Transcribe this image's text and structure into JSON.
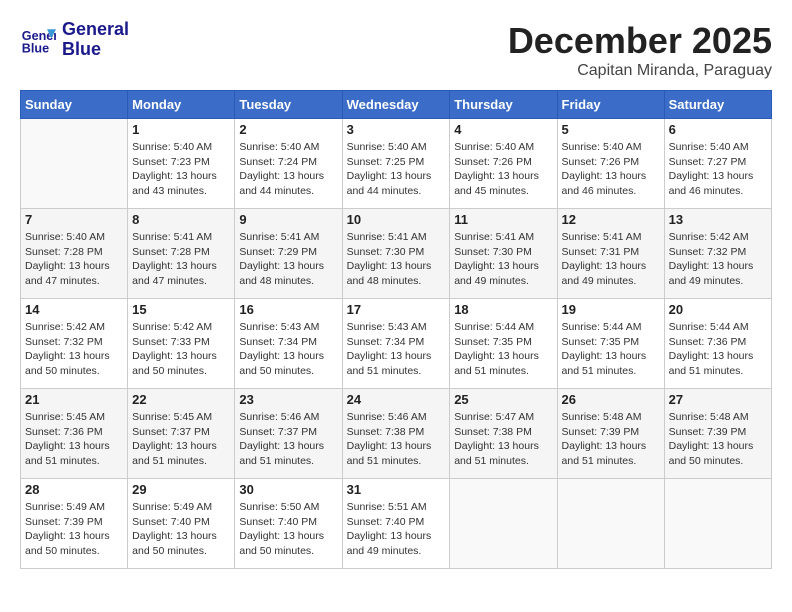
{
  "header": {
    "logo_line1": "General",
    "logo_line2": "Blue",
    "month_year": "December 2025",
    "location": "Capitan Miranda, Paraguay"
  },
  "weekdays": [
    "Sunday",
    "Monday",
    "Tuesday",
    "Wednesday",
    "Thursday",
    "Friday",
    "Saturday"
  ],
  "weeks": [
    [
      {
        "day": "",
        "info": ""
      },
      {
        "day": "1",
        "info": "Sunrise: 5:40 AM\nSunset: 7:23 PM\nDaylight: 13 hours\nand 43 minutes."
      },
      {
        "day": "2",
        "info": "Sunrise: 5:40 AM\nSunset: 7:24 PM\nDaylight: 13 hours\nand 44 minutes."
      },
      {
        "day": "3",
        "info": "Sunrise: 5:40 AM\nSunset: 7:25 PM\nDaylight: 13 hours\nand 44 minutes."
      },
      {
        "day": "4",
        "info": "Sunrise: 5:40 AM\nSunset: 7:26 PM\nDaylight: 13 hours\nand 45 minutes."
      },
      {
        "day": "5",
        "info": "Sunrise: 5:40 AM\nSunset: 7:26 PM\nDaylight: 13 hours\nand 46 minutes."
      },
      {
        "day": "6",
        "info": "Sunrise: 5:40 AM\nSunset: 7:27 PM\nDaylight: 13 hours\nand 46 minutes."
      }
    ],
    [
      {
        "day": "7",
        "info": "Sunrise: 5:40 AM\nSunset: 7:28 PM\nDaylight: 13 hours\nand 47 minutes."
      },
      {
        "day": "8",
        "info": "Sunrise: 5:41 AM\nSunset: 7:28 PM\nDaylight: 13 hours\nand 47 minutes."
      },
      {
        "day": "9",
        "info": "Sunrise: 5:41 AM\nSunset: 7:29 PM\nDaylight: 13 hours\nand 48 minutes."
      },
      {
        "day": "10",
        "info": "Sunrise: 5:41 AM\nSunset: 7:30 PM\nDaylight: 13 hours\nand 48 minutes."
      },
      {
        "day": "11",
        "info": "Sunrise: 5:41 AM\nSunset: 7:30 PM\nDaylight: 13 hours\nand 49 minutes."
      },
      {
        "day": "12",
        "info": "Sunrise: 5:41 AM\nSunset: 7:31 PM\nDaylight: 13 hours\nand 49 minutes."
      },
      {
        "day": "13",
        "info": "Sunrise: 5:42 AM\nSunset: 7:32 PM\nDaylight: 13 hours\nand 49 minutes."
      }
    ],
    [
      {
        "day": "14",
        "info": "Sunrise: 5:42 AM\nSunset: 7:32 PM\nDaylight: 13 hours\nand 50 minutes."
      },
      {
        "day": "15",
        "info": "Sunrise: 5:42 AM\nSunset: 7:33 PM\nDaylight: 13 hours\nand 50 minutes."
      },
      {
        "day": "16",
        "info": "Sunrise: 5:43 AM\nSunset: 7:34 PM\nDaylight: 13 hours\nand 50 minutes."
      },
      {
        "day": "17",
        "info": "Sunrise: 5:43 AM\nSunset: 7:34 PM\nDaylight: 13 hours\nand 51 minutes."
      },
      {
        "day": "18",
        "info": "Sunrise: 5:44 AM\nSunset: 7:35 PM\nDaylight: 13 hours\nand 51 minutes."
      },
      {
        "day": "19",
        "info": "Sunrise: 5:44 AM\nSunset: 7:35 PM\nDaylight: 13 hours\nand 51 minutes."
      },
      {
        "day": "20",
        "info": "Sunrise: 5:44 AM\nSunset: 7:36 PM\nDaylight: 13 hours\nand 51 minutes."
      }
    ],
    [
      {
        "day": "21",
        "info": "Sunrise: 5:45 AM\nSunset: 7:36 PM\nDaylight: 13 hours\nand 51 minutes."
      },
      {
        "day": "22",
        "info": "Sunrise: 5:45 AM\nSunset: 7:37 PM\nDaylight: 13 hours\nand 51 minutes."
      },
      {
        "day": "23",
        "info": "Sunrise: 5:46 AM\nSunset: 7:37 PM\nDaylight: 13 hours\nand 51 minutes."
      },
      {
        "day": "24",
        "info": "Sunrise: 5:46 AM\nSunset: 7:38 PM\nDaylight: 13 hours\nand 51 minutes."
      },
      {
        "day": "25",
        "info": "Sunrise: 5:47 AM\nSunset: 7:38 PM\nDaylight: 13 hours\nand 51 minutes."
      },
      {
        "day": "26",
        "info": "Sunrise: 5:48 AM\nSunset: 7:39 PM\nDaylight: 13 hours\nand 51 minutes."
      },
      {
        "day": "27",
        "info": "Sunrise: 5:48 AM\nSunset: 7:39 PM\nDaylight: 13 hours\nand 50 minutes."
      }
    ],
    [
      {
        "day": "28",
        "info": "Sunrise: 5:49 AM\nSunset: 7:39 PM\nDaylight: 13 hours\nand 50 minutes."
      },
      {
        "day": "29",
        "info": "Sunrise: 5:49 AM\nSunset: 7:40 PM\nDaylight: 13 hours\nand 50 minutes."
      },
      {
        "day": "30",
        "info": "Sunrise: 5:50 AM\nSunset: 7:40 PM\nDaylight: 13 hours\nand 50 minutes."
      },
      {
        "day": "31",
        "info": "Sunrise: 5:51 AM\nSunset: 7:40 PM\nDaylight: 13 hours\nand 49 minutes."
      },
      {
        "day": "",
        "info": ""
      },
      {
        "day": "",
        "info": ""
      },
      {
        "day": "",
        "info": ""
      }
    ]
  ]
}
